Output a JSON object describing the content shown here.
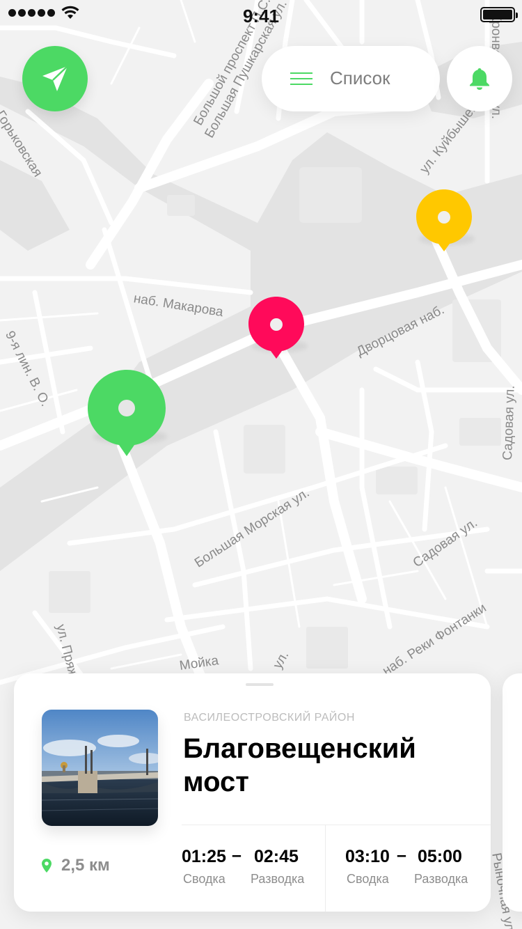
{
  "status_bar": {
    "time": "9:41"
  },
  "top_bar": {
    "list_label": "Список"
  },
  "map": {
    "streets": [
      "Большой проспект П.С.",
      "Большая Пушкарская ул.",
      "ул. Куйбышева",
      "наб. Макарова",
      "Дворцовая наб.",
      "9-я лин. В. О.",
      "Большая Морская ул.",
      "Садовая ул.",
      "Садовая ул.",
      "наб. Реки Фонтанки",
      "ул. Пряжки",
      "Мойка",
      "ул.",
      "Кронверкская ул.",
      "Горьковская",
      "Рыночная ул."
    ],
    "pins": [
      {
        "id": "green",
        "color": "#4cd964",
        "state": "selected"
      },
      {
        "id": "red",
        "color": "#ff0a5a",
        "state": "default"
      },
      {
        "id": "yellow",
        "color": "#ffc800",
        "state": "default"
      }
    ]
  },
  "card": {
    "district": "ВАСИЛЕОСТРОВСКИЙ РАЙОН",
    "name": "Благовещенский мост",
    "distance": "2,5 км",
    "schedules": [
      {
        "from": "01:25",
        "to": "02:45",
        "from_label": "Сводка",
        "to_label": "Разводка"
      },
      {
        "from": "03:10",
        "to": "05:00",
        "from_label": "Сводка",
        "to_label": "Разводка"
      }
    ],
    "dash": "–"
  },
  "colors": {
    "accent": "#4cd964",
    "red_pin": "#ff0a5a",
    "yellow_pin": "#ffc800",
    "water": "#e4e4e4",
    "land": "#f2f2f2",
    "road": "#ffffff"
  }
}
